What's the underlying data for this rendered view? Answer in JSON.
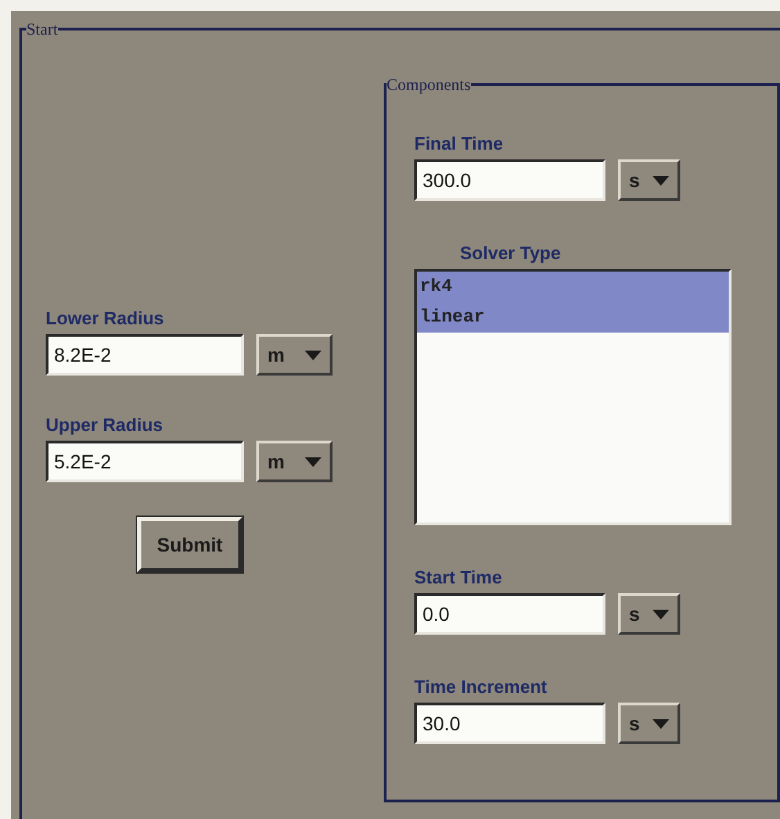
{
  "panel": {
    "title": "Start"
  },
  "left_fields": [
    {
      "label": "Lower Radius",
      "value": "8.2E-2",
      "unit": "m"
    },
    {
      "label": "Upper Radius",
      "value": "5.2E-2",
      "unit": "m"
    }
  ],
  "submit_button": "Submit",
  "components": {
    "title": "Components",
    "items": [
      {
        "kind": "field",
        "label": "Final Time",
        "value": "300.0",
        "unit": "s"
      },
      {
        "kind": "list",
        "label": "Solver Type",
        "options": [
          {
            "label": "rk4",
            "selected": true
          },
          {
            "label": "linear",
            "selected": true
          }
        ]
      },
      {
        "kind": "field",
        "label": "Start Time",
        "value": "0.0",
        "unit": "s"
      },
      {
        "kind": "field",
        "label": "Time Increment",
        "value": "30.0",
        "unit": "s"
      }
    ]
  }
}
